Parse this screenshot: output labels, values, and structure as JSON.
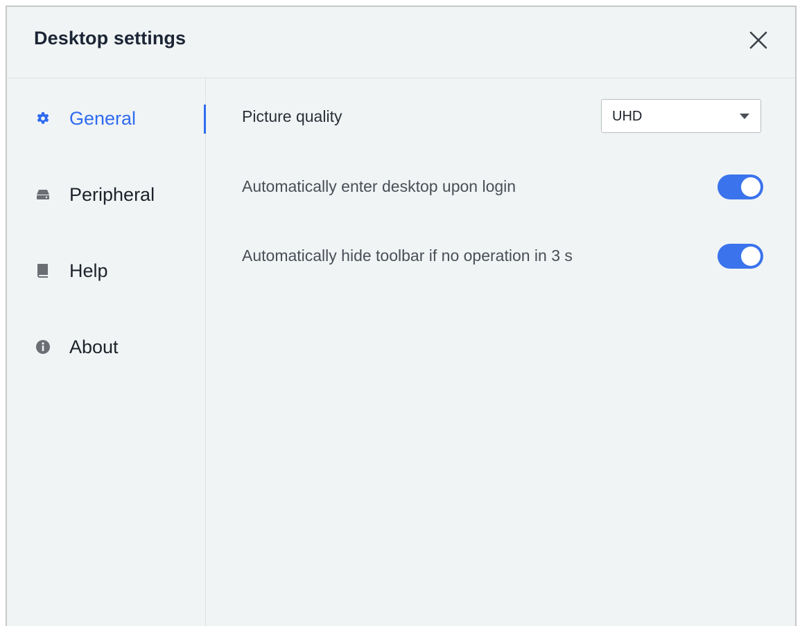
{
  "dialog": {
    "title": "Desktop settings"
  },
  "sidebar": {
    "items": [
      {
        "label": "General",
        "icon": "gear-icon",
        "active": true
      },
      {
        "label": "Peripheral",
        "icon": "drive-icon",
        "active": false
      },
      {
        "label": "Help",
        "icon": "book-icon",
        "active": false
      },
      {
        "label": "About",
        "icon": "info-icon",
        "active": false
      }
    ]
  },
  "general": {
    "picture_quality_label": "Picture quality",
    "picture_quality_value": "UHD",
    "auto_enter_label": "Automatically enter desktop upon login",
    "auto_enter_on": true,
    "auto_hide_label": "Automatically hide toolbar if no operation in 3 s",
    "auto_hide_on": true
  },
  "colors": {
    "accent": "#2f6bf0",
    "toggle_on": "#3b73ec",
    "background": "#f0f4f5",
    "icon_gray": "#6b6e73"
  }
}
